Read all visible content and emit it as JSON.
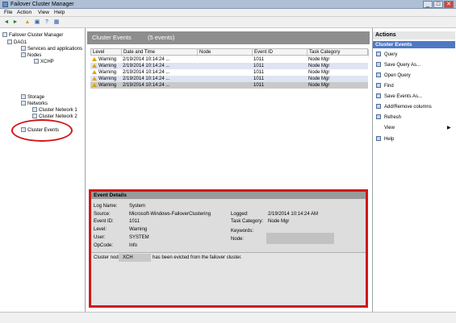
{
  "window": {
    "title": "Failover Cluster Manager",
    "min": "_",
    "max": "□",
    "close": "✕"
  },
  "menu": [
    "File",
    "Action",
    "View",
    "Help"
  ],
  "toolbar": {
    "back": "◄",
    "forward": "►",
    "up": "▲",
    "icon1": "▣",
    "icon2": "?",
    "icon3": "▦"
  },
  "tree": {
    "root": "Failover Cluster Manager",
    "cluster": "DAG1",
    "services": "Services and applications",
    "nodes": "Nodes",
    "node1": "XCHP",
    "storage": "Storage",
    "networks": "Networks",
    "net1": "Cluster Network 1",
    "net2": "Cluster Network 2",
    "events": "Cluster Events"
  },
  "events_panel": {
    "title": "Cluster Events",
    "count": "(5 events)"
  },
  "columns": [
    "Level",
    "Date and Time",
    "Node",
    "Event ID",
    "Task Category"
  ],
  "rows": [
    {
      "level": "Warning",
      "date": "2/19/2014 10:14:24 ...",
      "node": "",
      "id": "1011",
      "cat": "Node Mgr"
    },
    {
      "level": "Warning",
      "date": "2/19/2014 10:14:24 ...",
      "node": "",
      "id": "1011",
      "cat": "Node Mgr"
    },
    {
      "level": "Warning",
      "date": "2/19/2014 10:14:24 ...",
      "node": "",
      "id": "1011",
      "cat": "Node Mgr"
    },
    {
      "level": "Warning",
      "date": "2/19/2014 10:14:24 ...",
      "node": "",
      "id": "1011",
      "cat": "Node Mgr"
    },
    {
      "level": "Warning",
      "date": "2/19/2014 10:14:24 ...",
      "node": "",
      "id": "1011",
      "cat": "Node Mgr"
    }
  ],
  "details": {
    "title": "Event Details",
    "log_label": "Log Name:",
    "log_value": "System",
    "source_label": "Source:",
    "source_value": "Microsoft-Windows-FailoverClustering",
    "eventid_label": "Event ID:",
    "eventid_value": "1011",
    "level_label": "Level:",
    "level_value": "Warning",
    "user_label": "User:",
    "user_value": "SYSTEM",
    "opcode_label": "OpCode:",
    "opcode_value": "Info",
    "logged_label": "Logged:",
    "logged_value": "2/19/2014 10:14:24 AM",
    "taskcat_label": "Task Category:",
    "taskcat_value": "Node Mgr",
    "keywords_label": "Keywords:",
    "node_label": "Node:",
    "message_a": "Cluster node",
    "message_node": "XCH",
    "message_b": "has been evicted from the failover cluster."
  },
  "actions": {
    "title": "Actions",
    "section": "Cluster Events",
    "items": [
      "Query",
      "Save Query As...",
      "Open Query",
      "Find",
      "Save Events As...",
      "Add/Remove columns",
      "Refresh",
      "View",
      "Help"
    ],
    "view_arrow": "▶"
  }
}
